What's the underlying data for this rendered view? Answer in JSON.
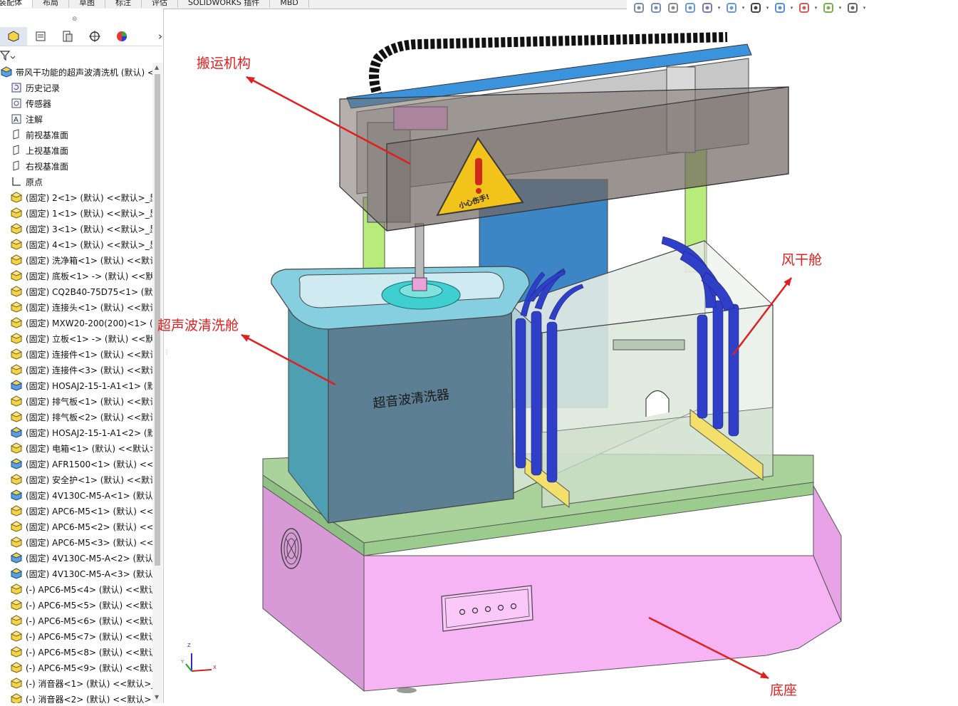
{
  "ribbon_tabs": [
    "装配体",
    "布局",
    "草图",
    "标注",
    "评估",
    "SOLIDWORKS 插件",
    "MBD"
  ],
  "hud_icons": [
    "zoom-to-fit-icon",
    "zoom-area-icon",
    "previous-view-icon",
    "section-view-icon",
    "dynamic-annotation-icon",
    "view-orientation-icon",
    "display-style-icon",
    "hide-show-icon",
    "edit-appearance-icon",
    "apply-scene-icon",
    "view-settings-icon"
  ],
  "panel_tab_icons": [
    "feature-manager-icon",
    "property-manager-icon",
    "configuration-manager-icon",
    "dimxpert-icon",
    "display-manager-icon"
  ],
  "tree": {
    "root": "带风干功能的超声波清洗机 (默认) <默",
    "items": [
      {
        "icon": "history-icon",
        "label": "历史记录"
      },
      {
        "icon": "sensor-icon",
        "label": "传感器"
      },
      {
        "icon": "annotation-icon",
        "label": "注解"
      },
      {
        "icon": "plane-icon",
        "label": "前视基准面"
      },
      {
        "icon": "plane-icon",
        "label": "上视基准面"
      },
      {
        "icon": "plane-icon",
        "label": "右视基准面"
      },
      {
        "icon": "origin-icon",
        "label": "原点"
      },
      {
        "icon": "part-icon",
        "label": "(固定) 2<1> (默认) <<默认>_显"
      },
      {
        "icon": "part-icon",
        "label": "(固定) 1<1> (默认) <<默认>_显"
      },
      {
        "icon": "part-icon",
        "label": "(固定) 3<1> (默认) <<默认>_显"
      },
      {
        "icon": "part-icon",
        "label": "(固定) 4<1> (默认) <<默认>_显"
      },
      {
        "icon": "part-icon",
        "label": "(固定) 洗净箱<1> (默认) <<默认"
      },
      {
        "icon": "part-icon",
        "label": "(固定) 底板<1> -> (默认) <<默"
      },
      {
        "icon": "part-icon",
        "label": "(固定) CQ2B40-75D75<1> (默认"
      },
      {
        "icon": "part-icon",
        "label": "(固定) 连接头<1> (默认) <<默认"
      },
      {
        "icon": "part-icon",
        "label": "(固定) MXW20-200(200)<1> (默"
      },
      {
        "icon": "part-icon",
        "label": "(固定) 立板<1> -> (默认) <<默"
      },
      {
        "icon": "part-icon",
        "label": "(固定) 连接件<1> (默认) <<默认"
      },
      {
        "icon": "part-icon",
        "label": "(固定) 连接件<3> (默认) <<默认"
      },
      {
        "icon": "assembly-icon",
        "label": "(固定) HOSAJ2-15-1-A1<1> (默"
      },
      {
        "icon": "part-icon",
        "label": "(固定) 排气板<1> (默认) <<默认"
      },
      {
        "icon": "part-icon",
        "label": "(固定) 排气板<2> (默认) <<默认"
      },
      {
        "icon": "assembly-icon",
        "label": "(固定) HOSAJ2-15-1-A1<2> (默"
      },
      {
        "icon": "part-icon",
        "label": "(固定) 电箱<1> (默认) <<默认>"
      },
      {
        "icon": "assembly-icon",
        "label": "(固定) AFR1500<1> (默认) <<默"
      },
      {
        "icon": "part-icon",
        "label": "(固定) 安全护<1> (默认) <<默认"
      },
      {
        "icon": "assembly-icon",
        "label": "(固定) 4V130C-M5-A<1> (默认"
      },
      {
        "icon": "part-icon",
        "label": "(固定) APC6-M5<1> (默认) <<"
      },
      {
        "icon": "part-icon",
        "label": "(固定) APC6-M5<2> (默认) <<"
      },
      {
        "icon": "part-icon",
        "label": "(固定) APC6-M5<3> (默认) <<"
      },
      {
        "icon": "assembly-icon",
        "label": "(固定) 4V130C-M5-A<2> (默认"
      },
      {
        "icon": "assembly-icon",
        "label": "(固定) 4V130C-M5-A<3> (默认"
      },
      {
        "icon": "part-icon",
        "label": "(-) APC6-M5<4> (默认) <<默认"
      },
      {
        "icon": "part-icon",
        "label": "(-) APC6-M5<5> (默认) <<默认"
      },
      {
        "icon": "part-icon",
        "label": "(-) APC6-M5<6> (默认) <<默认"
      },
      {
        "icon": "part-icon",
        "label": "(-) APC6-M5<7> (默认) <<默认"
      },
      {
        "icon": "part-icon",
        "label": "(-) APC6-M5<8> (默认) <<默认"
      },
      {
        "icon": "part-icon",
        "label": "(-) APC6-M5<9> (默认) <<默认"
      },
      {
        "icon": "part-icon",
        "label": "(-) 消音器<1> (默认) <<默认>_"
      },
      {
        "icon": "part-icon",
        "label": "(-) 消音器<2> (默认) <<默认>_"
      }
    ]
  },
  "callouts": {
    "transport": "搬运机构",
    "ultrasonic": "超声波清洗舱",
    "dryer": "风干舱",
    "base": "底座"
  },
  "model": {
    "cleaner_label": "超音波清洗器",
    "warning_label": "小心伤手!"
  },
  "triad": {
    "x": "X",
    "y": "Y",
    "z": "Z"
  },
  "colors": {
    "annotation": "#e02020",
    "base": "#f7b4f5",
    "deck": "#a9d39a",
    "frame": "#b8ec7a",
    "tank": "#7fc3d8",
    "hose": "#2f3fc8",
    "plate": "#f3e06a"
  }
}
